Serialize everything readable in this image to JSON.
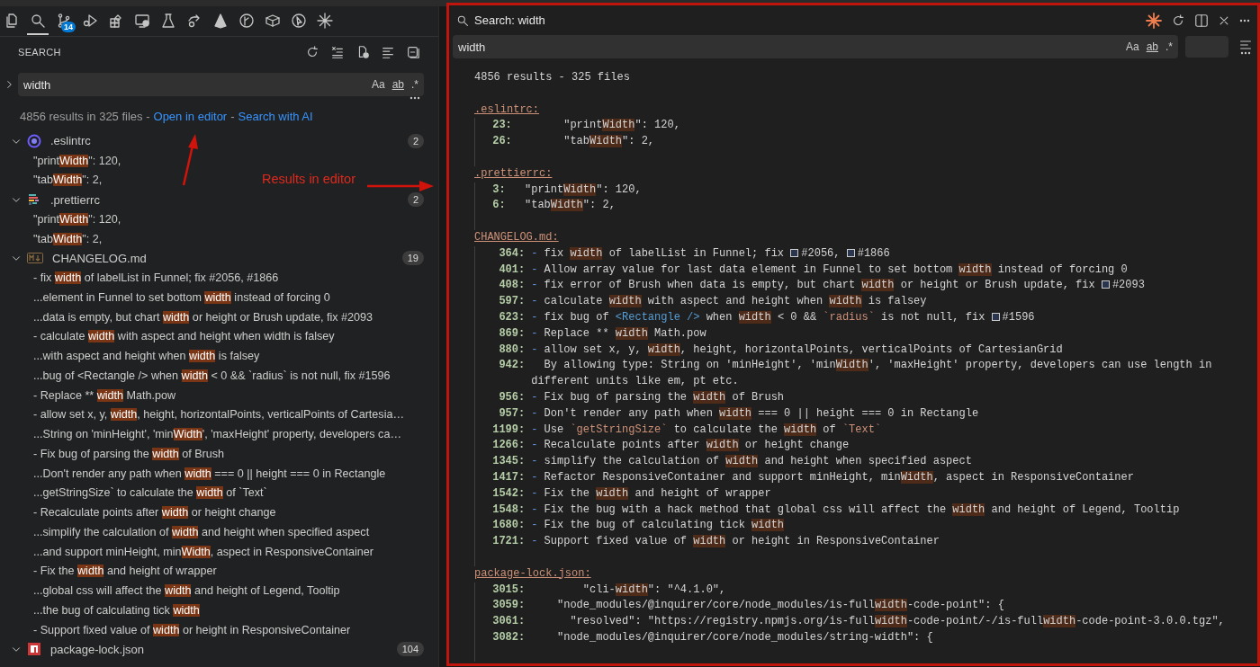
{
  "activity_bar": {
    "items": [
      {
        "kind": "files",
        "selected": false
      },
      {
        "kind": "search",
        "selected": true
      },
      {
        "kind": "branch",
        "selected": false,
        "badge": "14"
      },
      {
        "kind": "run",
        "selected": false
      },
      {
        "kind": "blocks",
        "selected": false
      },
      {
        "kind": "monitor",
        "selected": false
      },
      {
        "kind": "flask",
        "selected": false
      },
      {
        "kind": "share",
        "selected": false
      },
      {
        "kind": "prism",
        "selected": false
      },
      {
        "kind": "graph",
        "selected": false
      },
      {
        "kind": "box",
        "selected": false
      },
      {
        "kind": "pointer",
        "selected": false
      },
      {
        "kind": "sparkle",
        "selected": false
      }
    ]
  },
  "sidebar": {
    "title": "SEARCH",
    "search": {
      "value": "width",
      "replace_expanded": false,
      "toggles": [
        "Aa",
        "ab",
        ".*"
      ]
    },
    "summary": [
      {
        "kind": "text",
        "text": "4856 results in 325 files -"
      },
      {
        "kind": "link",
        "text": "Open in editor"
      },
      {
        "kind": "text",
        "text": "-"
      },
      {
        "kind": "link",
        "text": "Search with AI"
      }
    ],
    "files": [
      {
        "name": ".eslintrc",
        "kind": "eslint",
        "count": "2",
        "expanded": true,
        "matches": [
          [
            "\"print",
            "Width",
            "\": 120,"
          ],
          [
            "\"tab",
            "Width",
            "\": 2,"
          ]
        ]
      },
      {
        "name": ".prettierrc",
        "kind": "prettier",
        "count": "2",
        "expanded": true,
        "matches": [
          [
            "\"print",
            "Width",
            "\": 120,"
          ],
          [
            "\"tab",
            "Width",
            "\": 2,"
          ]
        ]
      },
      {
        "name": "CHANGELOG.md",
        "kind": "markdown",
        "count": "19",
        "expanded": true,
        "matches": [
          [
            "- fix ",
            "width",
            " of labelList in Funnel; fix #2056, #1866"
          ],
          [
            "...element in Funnel to set bottom ",
            "width",
            " instead of forcing 0"
          ],
          [
            "...data is empty, but chart ",
            "width",
            " or height or Brush update, fix #2093"
          ],
          [
            "- calculate ",
            "width",
            " with aspect and height when width is falsey"
          ],
          [
            "...with aspect and height when ",
            "width",
            " is falsey"
          ],
          [
            "...bug of <Rectangle /> when ",
            "width",
            " < 0 && `radius` is not null, fix #1596"
          ],
          [
            "- Replace ** ",
            "width",
            " Math.pow"
          ],
          [
            "- allow set x, y, ",
            "width",
            ", height, horizontalPoints, verticalPoints of Cartesia…"
          ],
          [
            "...String on 'minHeight', 'min",
            "Width",
            "', 'maxHeight' property, developers ca…"
          ],
          [
            "- Fix bug of parsing the ",
            "width",
            " of Brush"
          ],
          [
            "...Don't render any path when ",
            "width",
            " === 0 || height === 0 in Rectangle"
          ],
          [
            "...getStringSize` to calculate the ",
            "width",
            " of `Text`"
          ],
          [
            "- Recalculate points after ",
            "width",
            " or height change"
          ],
          [
            "...simplify the calculation of ",
            "width",
            " and height when specified aspect"
          ],
          [
            "...and support minHeight, min",
            "Width",
            ", aspect in ResponsiveContainer"
          ],
          [
            "- Fix the ",
            "width",
            " and height of wrapper"
          ],
          [
            "...global css will affect the ",
            "width",
            " and height of Legend, Tooltip"
          ],
          [
            "...the bug of calculating tick ",
            "width"
          ],
          [
            "- Support fixed value of ",
            "width",
            " or height in ResponsiveContainer"
          ]
        ]
      },
      {
        "name": "package-lock.json",
        "kind": "npm",
        "count": "104",
        "expanded": true
      }
    ]
  },
  "annotation": {
    "label": "Results in editor"
  },
  "editor": {
    "title": "Search: width",
    "search": {
      "value": "width",
      "toggles": [
        "Aa",
        "ab",
        ".*"
      ]
    },
    "summary": "4856 results - 325 files",
    "files": [
      {
        "name": ".eslintrc:",
        "lines": [
          {
            "number": "23:",
            "segments": [
              {
                "kind": "text",
                "text": "       \"print"
              },
              {
                "kind": "match",
                "text": "Width"
              },
              {
                "kind": "text",
                "text": "\": 120,"
              }
            ]
          },
          {
            "number": "26:",
            "segments": [
              {
                "kind": "text",
                "text": "       \"tab"
              },
              {
                "kind": "match",
                "text": "Width"
              },
              {
                "kind": "text",
                "text": "\": 2,"
              }
            ]
          }
        ]
      },
      {
        "name": ".prettierrc:",
        "lines": [
          {
            "number": "3:",
            "segments": [
              {
                "kind": "text",
                "text": "  \"print"
              },
              {
                "kind": "match",
                "text": "Width"
              },
              {
                "kind": "text",
                "text": "\": 120,"
              }
            ]
          },
          {
            "number": "6:",
            "segments": [
              {
                "kind": "text",
                "text": "  \"tab"
              },
              {
                "kind": "match",
                "text": "Width"
              },
              {
                "kind": "text",
                "text": "\": 2,"
              }
            ]
          }
        ]
      },
      {
        "name": "CHANGELOG.md:",
        "lines": [
          {
            "number": "364:",
            "segments": [
              {
                "kind": "bullet",
                "text": "-"
              },
              {
                "kind": "text",
                "text": " fix "
              },
              {
                "kind": "match",
                "text": "width"
              },
              {
                "kind": "text",
                "text": " of labelList in Funnel; fix "
              },
              {
                "kind": "issue",
                "text": "#2056"
              },
              {
                "kind": "text",
                "text": ", "
              },
              {
                "kind": "issue",
                "text": "#1866"
              }
            ]
          },
          {
            "number": "401:",
            "segments": [
              {
                "kind": "bullet",
                "text": "-"
              },
              {
                "kind": "text",
                "text": " Allow array value for last data element in Funnel to set bottom "
              },
              {
                "kind": "match",
                "text": "width"
              },
              {
                "kind": "text",
                "text": " instead of forcing 0"
              }
            ]
          },
          {
            "number": "408:",
            "segments": [
              {
                "kind": "bullet",
                "text": "-"
              },
              {
                "kind": "text",
                "text": " fix error of Brush when data is empty, but chart "
              },
              {
                "kind": "match",
                "text": "width"
              },
              {
                "kind": "text",
                "text": " or height or Brush update, fix "
              },
              {
                "kind": "issue",
                "text": "#2093"
              }
            ]
          },
          {
            "number": "597:",
            "segments": [
              {
                "kind": "bullet",
                "text": "-"
              },
              {
                "kind": "text",
                "text": " calculate "
              },
              {
                "kind": "match",
                "text": "width"
              },
              {
                "kind": "text",
                "text": " with aspect and height when "
              },
              {
                "kind": "match",
                "text": "width"
              },
              {
                "kind": "text",
                "text": " is falsey"
              }
            ]
          },
          {
            "number": "623:",
            "segments": [
              {
                "kind": "bullet",
                "text": "-"
              },
              {
                "kind": "text",
                "text": " fix bug of "
              },
              {
                "kind": "tag",
                "text": "<Rectangle />"
              },
              {
                "kind": "text",
                "text": " when "
              },
              {
                "kind": "match",
                "text": "width"
              },
              {
                "kind": "text",
                "text": " < 0 && "
              },
              {
                "kind": "code",
                "text": "`radius`"
              },
              {
                "kind": "text",
                "text": " is not null, fix "
              },
              {
                "kind": "issue",
                "text": "#1596"
              }
            ]
          },
          {
            "number": "869:",
            "segments": [
              {
                "kind": "bullet",
                "text": "-"
              },
              {
                "kind": "text",
                "text": " Replace ** "
              },
              {
                "kind": "match",
                "text": "width"
              },
              {
                "kind": "text",
                "text": " Math.pow"
              }
            ]
          },
          {
            "number": "880:",
            "segments": [
              {
                "kind": "bullet",
                "text": "-"
              },
              {
                "kind": "text",
                "text": " allow set x, y, "
              },
              {
                "kind": "match",
                "text": "width"
              },
              {
                "kind": "text",
                "text": ", height, horizontalPoints, verticalPoints of CartesianGrid"
              }
            ]
          },
          {
            "number": "942:",
            "segments": [
              {
                "kind": "text",
                "text": "  By allowing type: String on 'minHeight', 'min"
              },
              {
                "kind": "match",
                "text": "Width"
              },
              {
                "kind": "text",
                "text": "', 'maxHeight' property, developers can use length in different units like em, pt etc."
              }
            ]
          },
          {
            "number": "956:",
            "segments": [
              {
                "kind": "bullet",
                "text": "-"
              },
              {
                "kind": "text",
                "text": " Fix bug of parsing the "
              },
              {
                "kind": "match",
                "text": "width"
              },
              {
                "kind": "text",
                "text": " of Brush"
              }
            ]
          },
          {
            "number": "957:",
            "segments": [
              {
                "kind": "bullet",
                "text": "-"
              },
              {
                "kind": "text",
                "text": " Don't render any path when "
              },
              {
                "kind": "match",
                "text": "width"
              },
              {
                "kind": "text",
                "text": " === 0 || height === 0 in Rectangle"
              }
            ]
          },
          {
            "number": "1199:",
            "segments": [
              {
                "kind": "bullet",
                "text": "-"
              },
              {
                "kind": "text",
                "text": " Use "
              },
              {
                "kind": "code",
                "text": "`getStringSize`"
              },
              {
                "kind": "text",
                "text": " to calculate the "
              },
              {
                "kind": "match",
                "text": "width"
              },
              {
                "kind": "text",
                "text": " of "
              },
              {
                "kind": "code",
                "text": "`Text`"
              }
            ]
          },
          {
            "number": "1266:",
            "segments": [
              {
                "kind": "bullet",
                "text": "-"
              },
              {
                "kind": "text",
                "text": " Recalculate points after "
              },
              {
                "kind": "match",
                "text": "width"
              },
              {
                "kind": "text",
                "text": " or height change"
              }
            ]
          },
          {
            "number": "1345:",
            "segments": [
              {
                "kind": "bullet",
                "text": "-"
              },
              {
                "kind": "text",
                "text": " simplify the calculation of "
              },
              {
                "kind": "match",
                "text": "width"
              },
              {
                "kind": "text",
                "text": " and height when specified aspect"
              }
            ]
          },
          {
            "number": "1417:",
            "segments": [
              {
                "kind": "bullet",
                "text": "-"
              },
              {
                "kind": "text",
                "text": " Refactor ResponsiveContainer and support minHeight, min"
              },
              {
                "kind": "match",
                "text": "Width"
              },
              {
                "kind": "text",
                "text": ", aspect in ResponsiveContainer"
              }
            ]
          },
          {
            "number": "1542:",
            "segments": [
              {
                "kind": "bullet",
                "text": "-"
              },
              {
                "kind": "text",
                "text": " Fix the "
              },
              {
                "kind": "match",
                "text": "width"
              },
              {
                "kind": "text",
                "text": " and height of wrapper"
              }
            ]
          },
          {
            "number": "1548:",
            "segments": [
              {
                "kind": "bullet",
                "text": "-"
              },
              {
                "kind": "text",
                "text": " Fix the bug with a hack method that global css will affect the "
              },
              {
                "kind": "match",
                "text": "width"
              },
              {
                "kind": "text",
                "text": " and height of Legend, Tooltip"
              }
            ]
          },
          {
            "number": "1680:",
            "segments": [
              {
                "kind": "bullet",
                "text": "-"
              },
              {
                "kind": "text",
                "text": " Fix the bug of calculating tick "
              },
              {
                "kind": "match",
                "text": "width"
              }
            ]
          },
          {
            "number": "1721:",
            "segments": [
              {
                "kind": "bullet",
                "text": "-"
              },
              {
                "kind": "text",
                "text": " Support fixed value of "
              },
              {
                "kind": "match",
                "text": "width"
              },
              {
                "kind": "text",
                "text": " or height in ResponsiveContainer"
              }
            ]
          }
        ]
      },
      {
        "name": "package-lock.json:",
        "lines": [
          {
            "number": "3015:",
            "segments": [
              {
                "kind": "text",
                "text": "        \"cli-"
              },
              {
                "kind": "match",
                "text": "width"
              },
              {
                "kind": "text",
                "text": "\": \"^4.1.0\","
              }
            ]
          },
          {
            "number": "3059:",
            "segments": [
              {
                "kind": "text",
                "text": "    \"node_modules/@inquirer/core/node_modules/is-full"
              },
              {
                "kind": "match",
                "text": "width"
              },
              {
                "kind": "text",
                "text": "-code-point\": {"
              }
            ]
          },
          {
            "number": "3061:",
            "segments": [
              {
                "kind": "text",
                "text": "      \"resolved\": \"https://registry.npmjs.org/is-full"
              },
              {
                "kind": "match",
                "text": "width"
              },
              {
                "kind": "text",
                "text": "-code-point/-/is-full"
              },
              {
                "kind": "match",
                "text": "width"
              },
              {
                "kind": "text",
                "text": "-code-point-3.0.0.tgz\","
              }
            ]
          },
          {
            "number": "3082:",
            "segments": [
              {
                "kind": "text",
                "text": "    \"node_modules/@inquirer/core/node_modules/string-width\": {"
              }
            ]
          }
        ]
      }
    ]
  }
}
